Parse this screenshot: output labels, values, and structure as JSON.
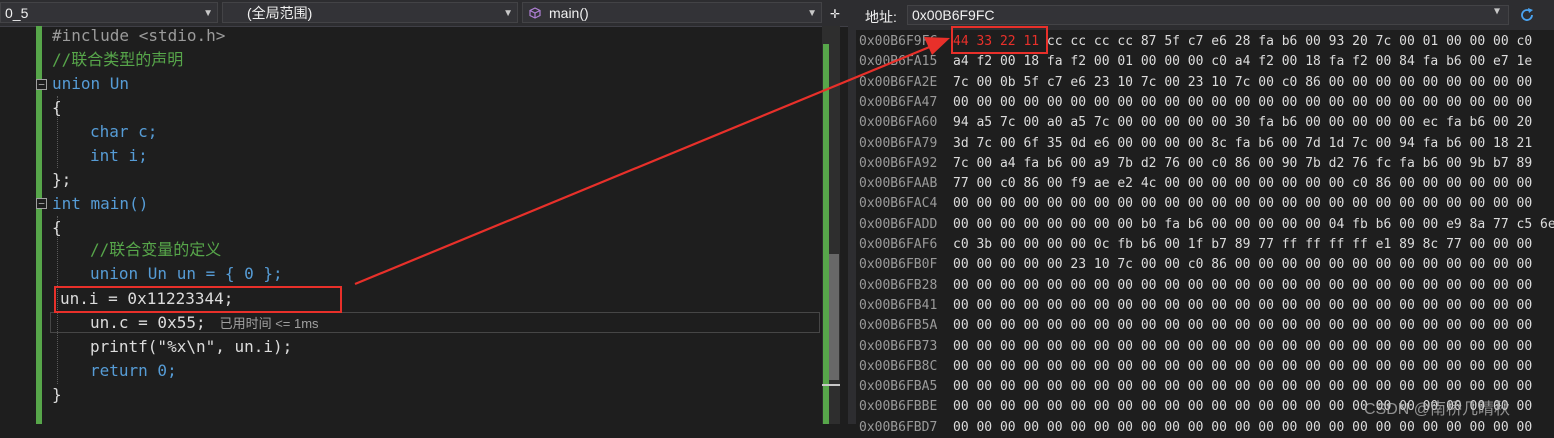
{
  "navbar": {
    "file_scope": "0_5",
    "global_scope": "(全局范围)",
    "function_scope": "main()"
  },
  "code": {
    "lines": [
      "#include <stdio.h>",
      "//联合类型的声明",
      "union Un",
      "{",
      "char c;",
      "int i;",
      "};",
      "int main()",
      "{",
      "//联合变量的定义",
      "union Un un = { 0 };",
      "un.i = 0x11223344;",
      "un.c = 0x55;",
      "printf(\"%x\\n\", un.i);",
      "return 0;",
      "}"
    ],
    "perf_hint": "已用时间 <= 1ms"
  },
  "memory": {
    "address_label": "地址:",
    "address_value": "0x00B6F9FC",
    "highlight_bytes": "44 33 22 11",
    "rows": [
      {
        "addr": "0x00B6F9FC",
        "bytes": "cc cc cc cc 87 5f c7 e6 28 fa b6 00 93 20 7c 00 01 00 00 00 c0"
      },
      {
        "addr": "0x00B6FA15",
        "bytes": "a4 f2 00 18 fa f2 00 01 00 00 00 c0 a4 f2 00 18 fa f2 00 84 fa b6 00 e7 1e"
      },
      {
        "addr": "0x00B6FA2E",
        "bytes": "7c 00 0b 5f c7 e6 23 10 7c 00 23 10 7c 00 c0 86 00 00 00 00 00 00 00 00 00"
      },
      {
        "addr": "0x00B6FA47",
        "bytes": "00 00 00 00 00 00 00 00 00 00 00 00 00 00 00 00 00 00 00 00 00 00 00 00 00"
      },
      {
        "addr": "0x00B6FA60",
        "bytes": "94 a5 7c 00 a0 a5 7c 00 00 00 00 00 30 fa b6 00 00 00 00 00 ec fa b6 00 20"
      },
      {
        "addr": "0x00B6FA79",
        "bytes": "3d 7c 00 6f 35 0d e6 00 00 00 00 8c fa b6 00 7d 1d 7c 00 94 fa b6 00 18 21"
      },
      {
        "addr": "0x00B6FA92",
        "bytes": "7c 00 a4 fa b6 00 a9 7b d2 76 00 c0 86 00 90 7b d2 76 fc fa b6 00 9b b7 89"
      },
      {
        "addr": "0x00B6FAAB",
        "bytes": "77 00 c0 86 00 f9 ae e2 4c 00 00 00 00 00 00 00 00 c0 86 00 00 00 00 00 00"
      },
      {
        "addr": "0x00B6FAC4",
        "bytes": "00 00 00 00 00 00 00 00 00 00 00 00 00 00 00 00 00 00 00 00 00 00 00 00 00"
      },
      {
        "addr": "0x00B6FADD",
        "bytes": "00 00 00 00 00 00 00 00 b0 fa b6 00 00 00 00 00 04 fb b6 00 00 e9 8a 77 c5 6e"
      },
      {
        "addr": "0x00B6FAF6",
        "bytes": "c0 3b 00 00 00 00 0c fb b6 00 1f b7 89 77 ff ff ff ff e1 89 8c 77 00 00 00"
      },
      {
        "addr": "0x00B6FB0F",
        "bytes": "00 00 00 00 00 23 10 7c 00 00 c0 86 00 00 00 00 00 00 00 00 00 00 00 00 00"
      },
      {
        "addr": "0x00B6FB28",
        "bytes": "00 00 00 00 00 00 00 00 00 00 00 00 00 00 00 00 00 00 00 00 00 00 00 00 00"
      },
      {
        "addr": "0x00B6FB41",
        "bytes": "00 00 00 00 00 00 00 00 00 00 00 00 00 00 00 00 00 00 00 00 00 00 00 00 00"
      },
      {
        "addr": "0x00B6FB5A",
        "bytes": "00 00 00 00 00 00 00 00 00 00 00 00 00 00 00 00 00 00 00 00 00 00 00 00 00"
      },
      {
        "addr": "0x00B6FB73",
        "bytes": "00 00 00 00 00 00 00 00 00 00 00 00 00 00 00 00 00 00 00 00 00 00 00 00 00"
      },
      {
        "addr": "0x00B6FB8C",
        "bytes": "00 00 00 00 00 00 00 00 00 00 00 00 00 00 00 00 00 00 00 00 00 00 00 00 00"
      },
      {
        "addr": "0x00B6FBA5",
        "bytes": "00 00 00 00 00 00 00 00 00 00 00 00 00 00 00 00 00 00 00 00 00 00 00 00 00"
      },
      {
        "addr": "0x00B6FBBE",
        "bytes": "00 00 00 00 00 00 00 00 00 00 00 00 00 00 00 00 00 00 00 00 00 00 00 00 00"
      },
      {
        "addr": "0x00B6FBD7",
        "bytes": "00 00 00 00 00 00 00 00 00 00 00 00 00 00 00 00 00 00 00 00 00 00 00 00 00"
      }
    ]
  },
  "watermark": "CSDN @南桥几晴秋",
  "icons": {
    "dropdown": "chevron-down-icon",
    "scope": "cube-icon",
    "split": "split-editor-icon",
    "refresh": "refresh-icon",
    "fold": "fold-minus-icon"
  },
  "colors": {
    "highlight_red": "#e8302a",
    "keyword": "#569cd6",
    "comment": "#57a64a",
    "number": "#b5cea8",
    "string": "#d69d85"
  }
}
